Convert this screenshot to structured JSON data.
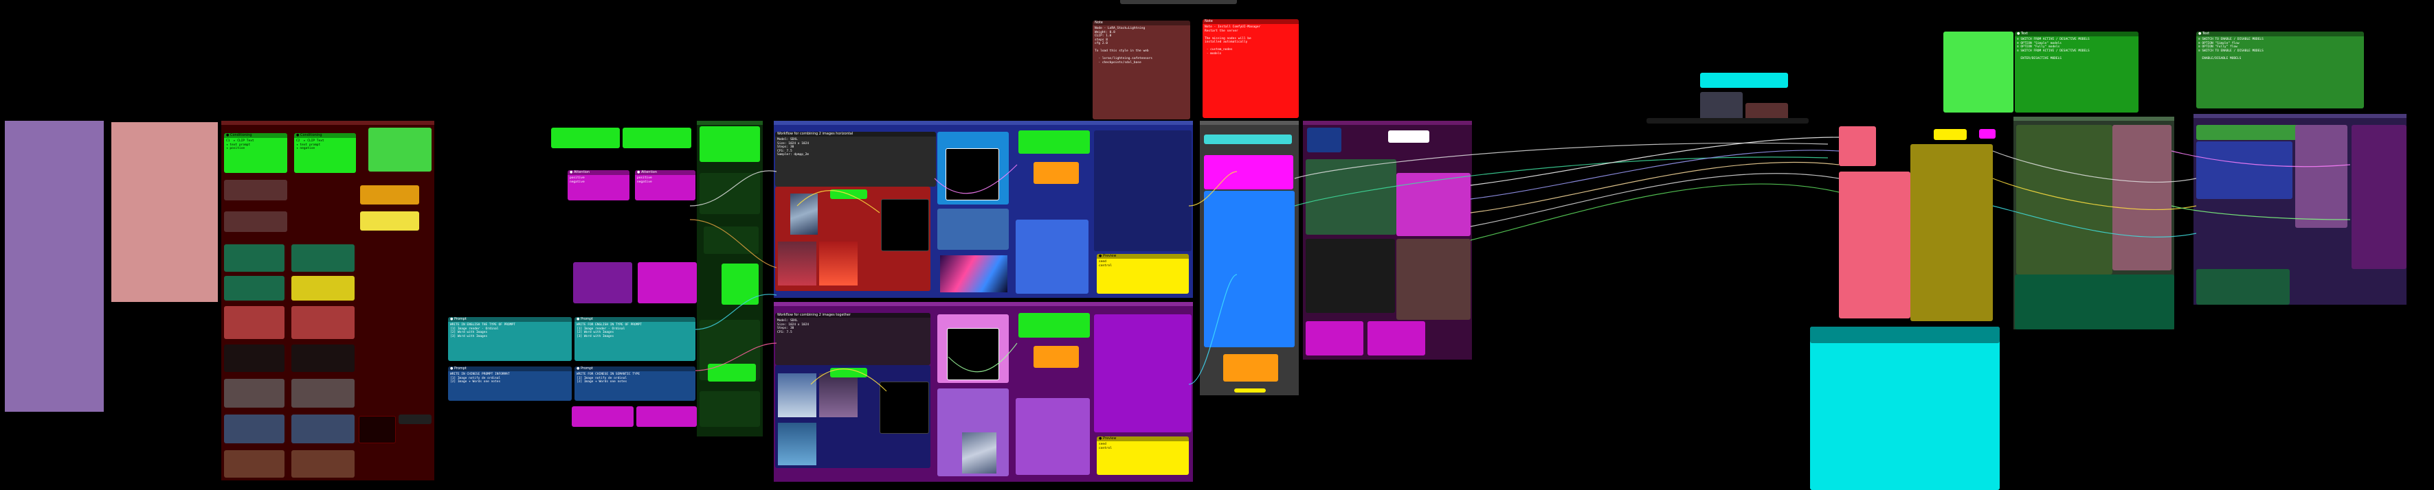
{
  "colors": {
    "bg": "#000000",
    "purple": "#8c6cae",
    "pink": "#d39292",
    "darkred": "#3a0000",
    "green": "#1ee61e",
    "teal": "#1a9a9a",
    "magenta": "#c814c8",
    "blue": "#1e2a8c",
    "brightblue": "#2080ff",
    "cyan": "#00e6e6",
    "olive": "#9a8a10",
    "rose": "#f0607a",
    "red": "#ff1010",
    "brown": "#6a2a2a",
    "yellow": "#ffee00",
    "orange": "#ff9a10"
  },
  "nodes": {
    "n_green1": {
      "title": "● Conditioning",
      "body": "C1  ▸ CLIP Text\n◂ text prompt\n◂ positive"
    },
    "n_green2": {
      "title": "● Conditioning",
      "body": "C2  ▸ CLIP Text\n◂ text prompt\n◂ negative"
    },
    "n_teal1": {
      "title": "● Prompt",
      "body": "WRITE IN ENGLISH THE TYPE OF PROMPT\n[1] Image render - Ordinal\n[2] Word with Images\n[3] Word with Images"
    },
    "n_teal2": {
      "title": "● Prompt",
      "body": "WRITE FOR ENGLISH IN TYPE OF PROMPT\n[1] Image render - Ordinal\n[2] Word with Images\n[3] Word with Images"
    },
    "n_blue1": {
      "title": "● Prompt",
      "body": "WRITE IN CHINESE PROMPT INFORMAT\n[1] Image notify de ordinal\n[2] Image + Words one notes"
    },
    "n_blue2": {
      "title": "● Prompt",
      "body": "WRITE FOR CHINESE IN SEMANTIC TYPE\n[1] Image notify de ordinal\n[2] Image + Words one notes"
    },
    "n_mag1": {
      "title": "● Attention",
      "body": "positive\nnegative"
    },
    "n_mag2": {
      "title": "● Attention",
      "body": "positive\nnegative"
    },
    "n_note1": {
      "title": "Workflow for combining 2 images horizontal",
      "body": "Model: SDXL\nSize: 1024 x 1024\nSteps: 30\nCFG: 7.5\nSampler: dpmpp_2m"
    },
    "n_note2": {
      "title": "Workflow for combining 2 images together",
      "body": "Model: SDXL\nSize: 1024 x 1024\nSteps: 30\nCFG: 7.5"
    },
    "n_brownnote": {
      "title": "Note",
      "body": "Node - LoRA_Stack=Lightning\nWeight: 0.8\nCLIP: 1.0\nsteps 8\ncfg 2.0\n\nTo load this style in the web\n\n  - loras/lightning.safetensors\n  - checkpoints/sdxl_base"
    },
    "n_rednote": {
      "title": "Note",
      "body": "Note - Install ComfyUI-Manager\nRestart the server\n\nThe missing nodes will be\ninstalled automatically\n\n - custom_nodes\n - models"
    },
    "n_g1": {
      "title": "● Text",
      "body": "≡ SWITCH FROM ACTIVE / DESACTIVE MODELS\n≡ OPTION \"Simple\" models\n≡ OPTION \"Fully\" models\n≡ SWITCH FROM ACTIVE / DESACTIVE MODELS\n\n  ENTER/DESACTIVE MODELS"
    },
    "n_g2": {
      "title": "● Text",
      "body": "≡ SWITCH TO ENABLE / DISABLE MODELS\n≡ OPTION \"Simple\" flow\n≡ OPTION \"Fully\" flow\n≡ SWITCH TO ENABLE / DISABLE MODELS\n\n  ENABLE/DISABLE MODELS"
    },
    "n_yel1": {
      "title": "● Preview",
      "body": "seed\ncontrol"
    },
    "n_yel2": {
      "title": "● Preview",
      "body": "seed\ncontrol"
    }
  }
}
